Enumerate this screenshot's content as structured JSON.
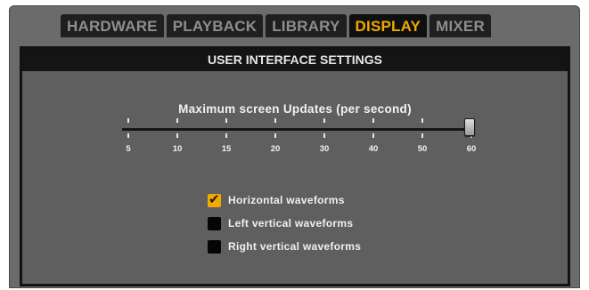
{
  "tabs": [
    {
      "label": "HARDWARE",
      "active": false
    },
    {
      "label": "PLAYBACK",
      "active": false
    },
    {
      "label": "LIBRARY",
      "active": false
    },
    {
      "label": "DISPLAY",
      "active": true
    },
    {
      "label": "MIXER",
      "active": false
    }
  ],
  "panel": {
    "title": "USER INTERFACE SETTINGS",
    "slider": {
      "label": "Maximum screen Updates (per second)",
      "ticks": [
        "5",
        "10",
        "15",
        "20",
        "30",
        "40",
        "50",
        "60"
      ],
      "value": "60"
    },
    "checkboxes": [
      {
        "label": "Horizontal waveforms",
        "checked": true
      },
      {
        "label": "Left vertical waveforms",
        "checked": false
      },
      {
        "label": "Right vertical waveforms",
        "checked": false
      }
    ]
  },
  "colors": {
    "accent": "#f2a900",
    "tab_inactive_text": "#8e8e8e",
    "panel_bg": "#5f5f5f"
  }
}
